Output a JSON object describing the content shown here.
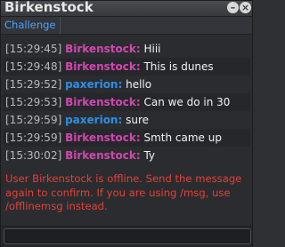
{
  "window": {
    "title": "Birkenstock",
    "minimize_glyph": "–",
    "close_glyph": "×"
  },
  "tabs": [
    {
      "label": "Challenge"
    }
  ],
  "colors": {
    "birkenstock": "#d147b0",
    "paxerion": "#2f8fe6",
    "notice": "#e2413a"
  },
  "messages": [
    {
      "time": "[15:29:45]",
      "user": "Birkenstock:",
      "text": "Hiii",
      "color": "#d147b0"
    },
    {
      "time": "[15:29:48]",
      "user": "Birkenstock:",
      "text": "This is dunes",
      "color": "#d147b0"
    },
    {
      "time": "[15:29:52]",
      "user": "paxerion:",
      "text": "hello",
      "color": "#2f8fe6"
    },
    {
      "time": "[15:29:53]",
      "user": "Birkenstock:",
      "text": "Can we do in 30",
      "color": "#d147b0"
    },
    {
      "time": "[15:29:59]",
      "user": "paxerion:",
      "text": "sure",
      "color": "#2f8fe6"
    },
    {
      "time": "[15:29:59]",
      "user": "Birkenstock:",
      "text": "Smth came up",
      "color": "#d147b0"
    },
    {
      "time": "[15:30:02]",
      "user": "Birkenstock:",
      "text": "Ty",
      "color": "#d147b0"
    }
  ],
  "notice": "User Birkenstock is offline. Send the message again to confirm. If you are using /msg, use /offlinemsg instead.",
  "input": {
    "value": "",
    "placeholder": ""
  }
}
